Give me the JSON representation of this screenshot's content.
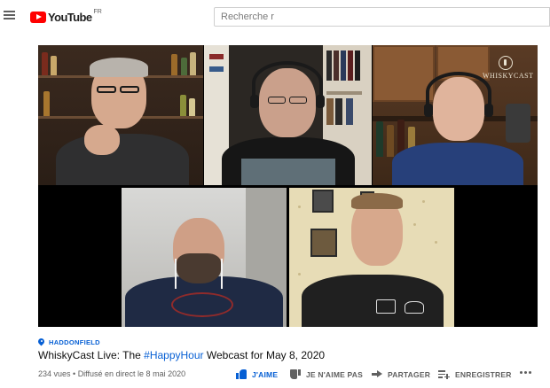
{
  "header": {
    "logo_text": "YouTube",
    "country_code": "FR",
    "search_placeholder": "Recherche r"
  },
  "video": {
    "location": "HADDONFIELD",
    "title_prefix": "WhiskyCast Live: The ",
    "title_hashtag": "#HappyHour",
    "title_suffix": " Webcast for May 8, 2020",
    "views": "234 vues",
    "separator": " • ",
    "streamed": "Diffusé en direct le 8 mai 2020",
    "watermark": "WHISKYCAST"
  },
  "actions": {
    "like": "J'AIME",
    "dislike": "JE N'AIME PAS",
    "share": "PARTAGER",
    "save": "ENREGISTRER"
  },
  "colors": {
    "brand_red": "#ff0000",
    "link_blue": "#065fd4",
    "meta_gray": "#606060"
  }
}
